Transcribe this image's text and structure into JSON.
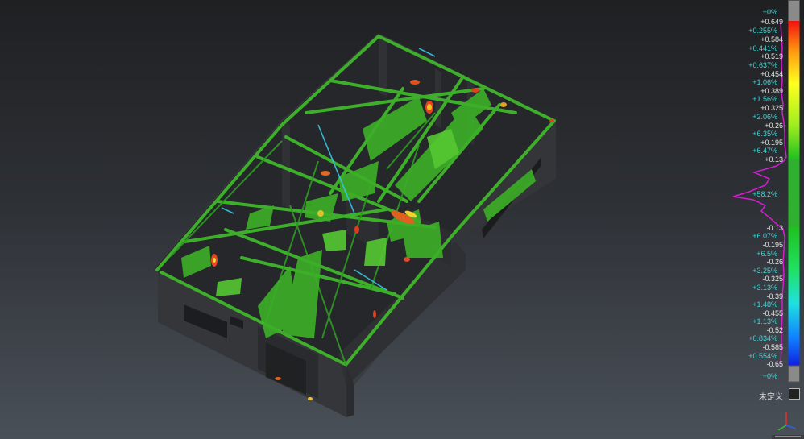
{
  "colormap": {
    "ticks": [
      {
        "type": "pct",
        "text": "+0%"
      },
      {
        "type": "val",
        "text": "+0.649"
      },
      {
        "type": "pct",
        "text": "+0.255%"
      },
      {
        "type": "val",
        "text": "+0.584"
      },
      {
        "type": "pct",
        "text": "+0.441%"
      },
      {
        "type": "val",
        "text": "+0.519"
      },
      {
        "type": "pct",
        "text": "+0.637%"
      },
      {
        "type": "val",
        "text": "+0.454"
      },
      {
        "type": "pct",
        "text": "+1.06%"
      },
      {
        "type": "val",
        "text": "+0.389"
      },
      {
        "type": "pct",
        "text": "+1.56%"
      },
      {
        "type": "val",
        "text": "+0.325"
      },
      {
        "type": "pct",
        "text": "+2.06%"
      },
      {
        "type": "val",
        "text": "+0.26"
      },
      {
        "type": "pct",
        "text": "+6.35%"
      },
      {
        "type": "val",
        "text": "+0.195"
      },
      {
        "type": "pct",
        "text": "+6.47%"
      },
      {
        "type": "val",
        "text": "+0.13"
      },
      {
        "type": "pct",
        "text": "+58.2%"
      },
      {
        "type": "val",
        "text": "-0.13"
      },
      {
        "type": "pct",
        "text": "+6.07%"
      },
      {
        "type": "val",
        "text": "-0.195"
      },
      {
        "type": "pct",
        "text": "+6.5%"
      },
      {
        "type": "val",
        "text": "-0.26"
      },
      {
        "type": "pct",
        "text": "+3.25%"
      },
      {
        "type": "val",
        "text": "-0.325"
      },
      {
        "type": "pct",
        "text": "+3.13%"
      },
      {
        "type": "val",
        "text": "-0.39"
      },
      {
        "type": "pct",
        "text": "+1.48%"
      },
      {
        "type": "val",
        "text": "-0.455"
      },
      {
        "type": "pct",
        "text": "+1.13%"
      },
      {
        "type": "val",
        "text": "-0.52"
      },
      {
        "type": "pct",
        "text": "+0.834%"
      },
      {
        "type": "val",
        "text": "-0.585"
      },
      {
        "type": "pct",
        "text": "+0.554%"
      },
      {
        "type": "val",
        "text": "-0.65"
      },
      {
        "type": "pct",
        "text": "+0%"
      }
    ],
    "undefined_label": "未定义",
    "colors": {
      "pct_text": "#3fd6d6",
      "val_text": "#e6e6e6",
      "histogram": "#d020d0",
      "out_of_range": "#8a8a8a"
    }
  }
}
